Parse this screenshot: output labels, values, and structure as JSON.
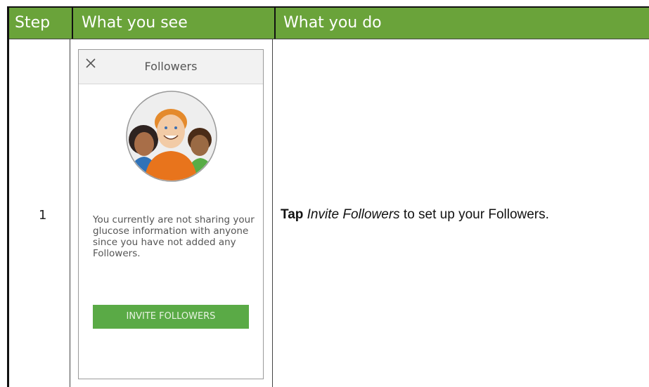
{
  "table": {
    "headers": {
      "step": "Step",
      "see": "What you see",
      "do": "What you do"
    },
    "rows": [
      {
        "step": "1",
        "action_bold": "Tap",
        "action_italic": "Invite Followers",
        "action_rest": " to set up your Followers."
      }
    ]
  },
  "phone": {
    "title": "Followers",
    "message": "You currently are not sharing your glucose information with anyone since you have not added any Followers.",
    "invite_button": "INVITE FOLLOWERS"
  },
  "icons": {
    "close": "close-icon",
    "avatar": "followers-illustration"
  },
  "colors": {
    "header_green": "#6aa33a",
    "button_green": "#5aaa46"
  }
}
